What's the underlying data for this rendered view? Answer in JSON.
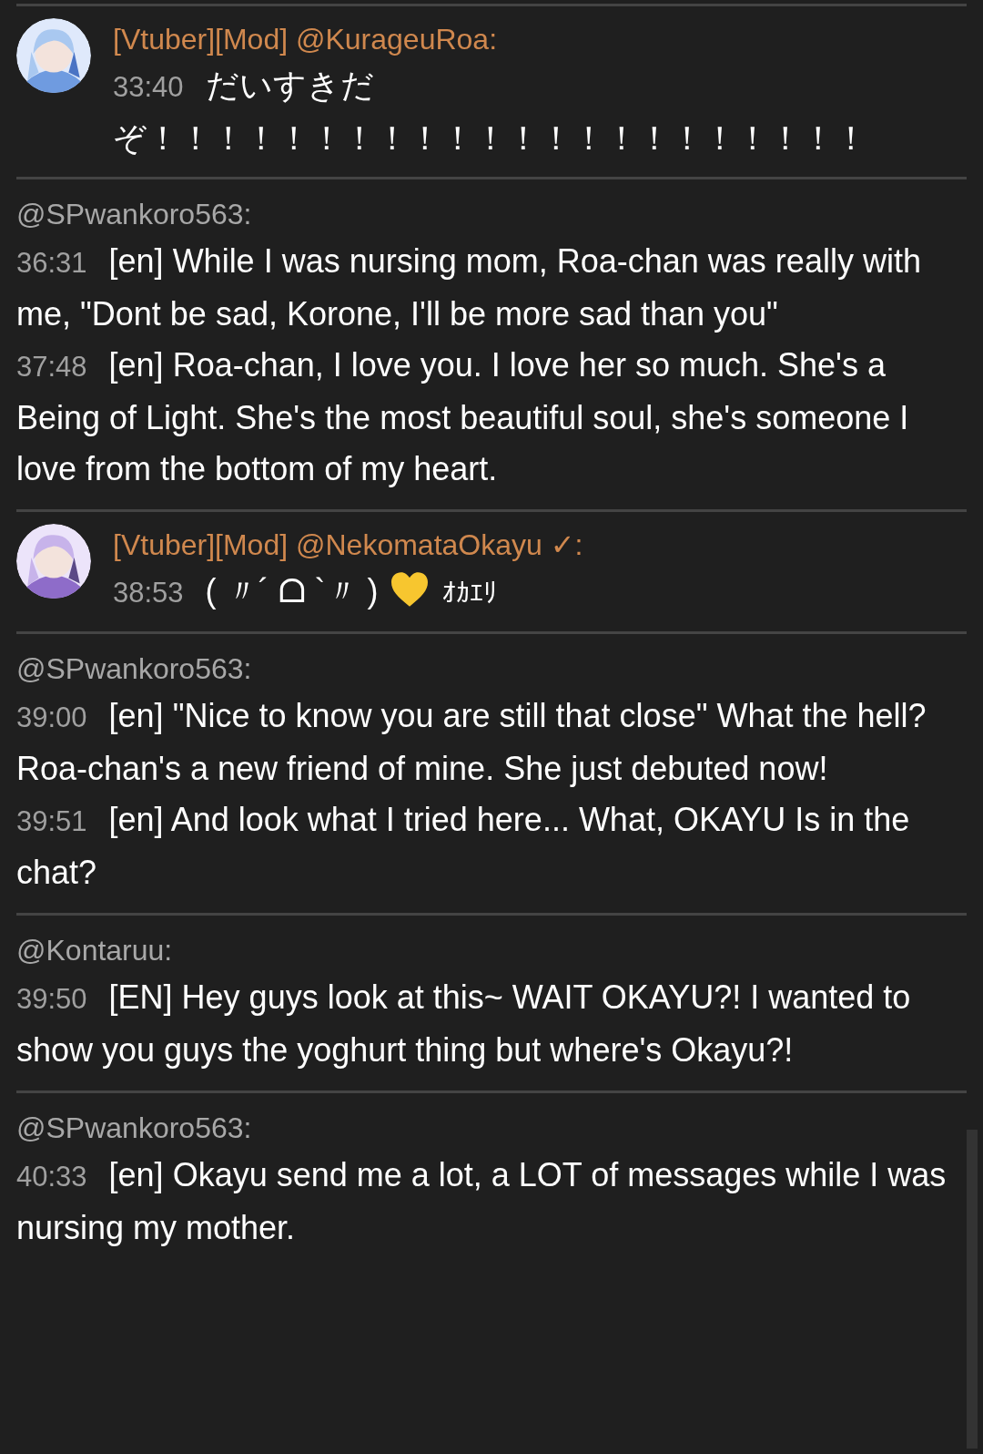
{
  "messages": [
    {
      "kind": "vtuber",
      "author": "[Vtuber][Mod] @KurageuRoa:",
      "lines": [
        {
          "time": "33:40",
          "text": "だいすきだぞ！！！！！！！！！！！！！！！！！！！！！！"
        }
      ]
    },
    {
      "kind": "user",
      "author": "@SPwankoro563:",
      "lines": [
        {
          "time": "36:31",
          "text": "[en] While I was nursing mom, Roa-chan was really with me, \"Dont be sad, Korone, I'll be more sad than you\""
        },
        {
          "time": "37:48",
          "text": "[en] Roa-chan, I love you. I love her so much. She's a Being of Light. She's the most beautiful soul, she's someone I love from the bottom of my heart."
        }
      ]
    },
    {
      "kind": "vtuber",
      "author": "[Vtuber][Mod] @NekomataOkayu ✓:",
      "lines": [
        {
          "time": "38:53",
          "text": "( 〃´ ᗝ `〃 )",
          "heart": true,
          "after": "ｵｶｴﾘ"
        }
      ]
    },
    {
      "kind": "user",
      "author": "@SPwankoro563:",
      "lines": [
        {
          "time": "39:00",
          "text": "[en] \"Nice to know you are still that close\" What the hell? Roa-chan's a new friend of mine. She just debuted now!"
        },
        {
          "time": "39:51",
          "text": "[en] And look what I tried here... What, OKAYU Is in the chat?"
        }
      ]
    },
    {
      "kind": "user",
      "author": "@Kontaruu:",
      "lines": [
        {
          "time": "39:50",
          "text": "[EN] Hey guys look at this~ WAIT OKAYU?! I wanted to show you guys the yoghurt thing but where's Okayu?!"
        }
      ]
    },
    {
      "kind": "user",
      "author": "@SPwankoro563:",
      "lines": [
        {
          "time": "40:33",
          "text": "[en] Okayu send me a lot, a LOT of messages while I was nursing my mother."
        }
      ]
    }
  ]
}
